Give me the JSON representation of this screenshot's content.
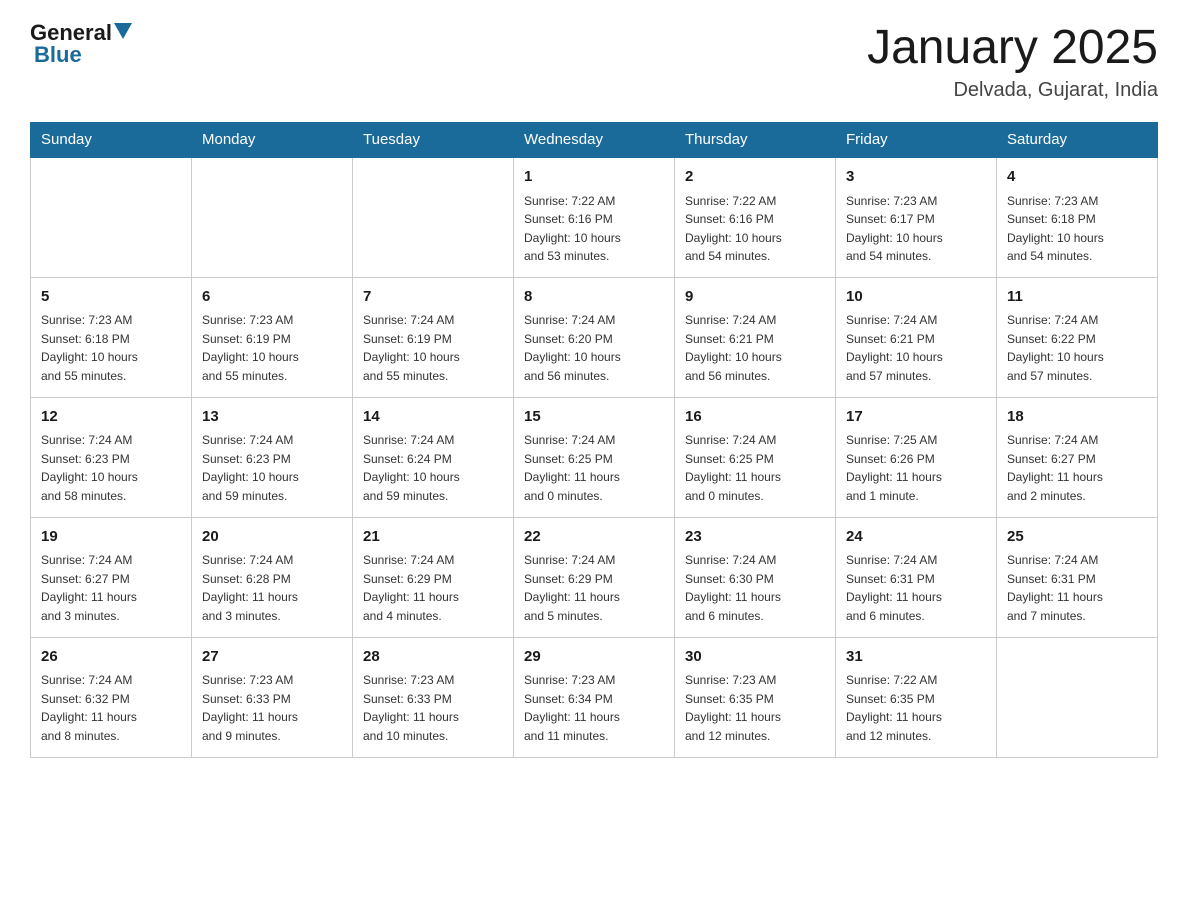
{
  "header": {
    "logo_general": "General",
    "logo_blue": "Blue",
    "title": "January 2025",
    "subtitle": "Delvada, Gujarat, India"
  },
  "weekdays": [
    "Sunday",
    "Monday",
    "Tuesday",
    "Wednesday",
    "Thursday",
    "Friday",
    "Saturday"
  ],
  "weeks": [
    [
      {
        "day": "",
        "info": ""
      },
      {
        "day": "",
        "info": ""
      },
      {
        "day": "",
        "info": ""
      },
      {
        "day": "1",
        "info": "Sunrise: 7:22 AM\nSunset: 6:16 PM\nDaylight: 10 hours\nand 53 minutes."
      },
      {
        "day": "2",
        "info": "Sunrise: 7:22 AM\nSunset: 6:16 PM\nDaylight: 10 hours\nand 54 minutes."
      },
      {
        "day": "3",
        "info": "Sunrise: 7:23 AM\nSunset: 6:17 PM\nDaylight: 10 hours\nand 54 minutes."
      },
      {
        "day": "4",
        "info": "Sunrise: 7:23 AM\nSunset: 6:18 PM\nDaylight: 10 hours\nand 54 minutes."
      }
    ],
    [
      {
        "day": "5",
        "info": "Sunrise: 7:23 AM\nSunset: 6:18 PM\nDaylight: 10 hours\nand 55 minutes."
      },
      {
        "day": "6",
        "info": "Sunrise: 7:23 AM\nSunset: 6:19 PM\nDaylight: 10 hours\nand 55 minutes."
      },
      {
        "day": "7",
        "info": "Sunrise: 7:24 AM\nSunset: 6:19 PM\nDaylight: 10 hours\nand 55 minutes."
      },
      {
        "day": "8",
        "info": "Sunrise: 7:24 AM\nSunset: 6:20 PM\nDaylight: 10 hours\nand 56 minutes."
      },
      {
        "day": "9",
        "info": "Sunrise: 7:24 AM\nSunset: 6:21 PM\nDaylight: 10 hours\nand 56 minutes."
      },
      {
        "day": "10",
        "info": "Sunrise: 7:24 AM\nSunset: 6:21 PM\nDaylight: 10 hours\nand 57 minutes."
      },
      {
        "day": "11",
        "info": "Sunrise: 7:24 AM\nSunset: 6:22 PM\nDaylight: 10 hours\nand 57 minutes."
      }
    ],
    [
      {
        "day": "12",
        "info": "Sunrise: 7:24 AM\nSunset: 6:23 PM\nDaylight: 10 hours\nand 58 minutes."
      },
      {
        "day": "13",
        "info": "Sunrise: 7:24 AM\nSunset: 6:23 PM\nDaylight: 10 hours\nand 59 minutes."
      },
      {
        "day": "14",
        "info": "Sunrise: 7:24 AM\nSunset: 6:24 PM\nDaylight: 10 hours\nand 59 minutes."
      },
      {
        "day": "15",
        "info": "Sunrise: 7:24 AM\nSunset: 6:25 PM\nDaylight: 11 hours\nand 0 minutes."
      },
      {
        "day": "16",
        "info": "Sunrise: 7:24 AM\nSunset: 6:25 PM\nDaylight: 11 hours\nand 0 minutes."
      },
      {
        "day": "17",
        "info": "Sunrise: 7:25 AM\nSunset: 6:26 PM\nDaylight: 11 hours\nand 1 minute."
      },
      {
        "day": "18",
        "info": "Sunrise: 7:24 AM\nSunset: 6:27 PM\nDaylight: 11 hours\nand 2 minutes."
      }
    ],
    [
      {
        "day": "19",
        "info": "Sunrise: 7:24 AM\nSunset: 6:27 PM\nDaylight: 11 hours\nand 3 minutes."
      },
      {
        "day": "20",
        "info": "Sunrise: 7:24 AM\nSunset: 6:28 PM\nDaylight: 11 hours\nand 3 minutes."
      },
      {
        "day": "21",
        "info": "Sunrise: 7:24 AM\nSunset: 6:29 PM\nDaylight: 11 hours\nand 4 minutes."
      },
      {
        "day": "22",
        "info": "Sunrise: 7:24 AM\nSunset: 6:29 PM\nDaylight: 11 hours\nand 5 minutes."
      },
      {
        "day": "23",
        "info": "Sunrise: 7:24 AM\nSunset: 6:30 PM\nDaylight: 11 hours\nand 6 minutes."
      },
      {
        "day": "24",
        "info": "Sunrise: 7:24 AM\nSunset: 6:31 PM\nDaylight: 11 hours\nand 6 minutes."
      },
      {
        "day": "25",
        "info": "Sunrise: 7:24 AM\nSunset: 6:31 PM\nDaylight: 11 hours\nand 7 minutes."
      }
    ],
    [
      {
        "day": "26",
        "info": "Sunrise: 7:24 AM\nSunset: 6:32 PM\nDaylight: 11 hours\nand 8 minutes."
      },
      {
        "day": "27",
        "info": "Sunrise: 7:23 AM\nSunset: 6:33 PM\nDaylight: 11 hours\nand 9 minutes."
      },
      {
        "day": "28",
        "info": "Sunrise: 7:23 AM\nSunset: 6:33 PM\nDaylight: 11 hours\nand 10 minutes."
      },
      {
        "day": "29",
        "info": "Sunrise: 7:23 AM\nSunset: 6:34 PM\nDaylight: 11 hours\nand 11 minutes."
      },
      {
        "day": "30",
        "info": "Sunrise: 7:23 AM\nSunset: 6:35 PM\nDaylight: 11 hours\nand 12 minutes."
      },
      {
        "day": "31",
        "info": "Sunrise: 7:22 AM\nSunset: 6:35 PM\nDaylight: 11 hours\nand 12 minutes."
      },
      {
        "day": "",
        "info": ""
      }
    ]
  ]
}
